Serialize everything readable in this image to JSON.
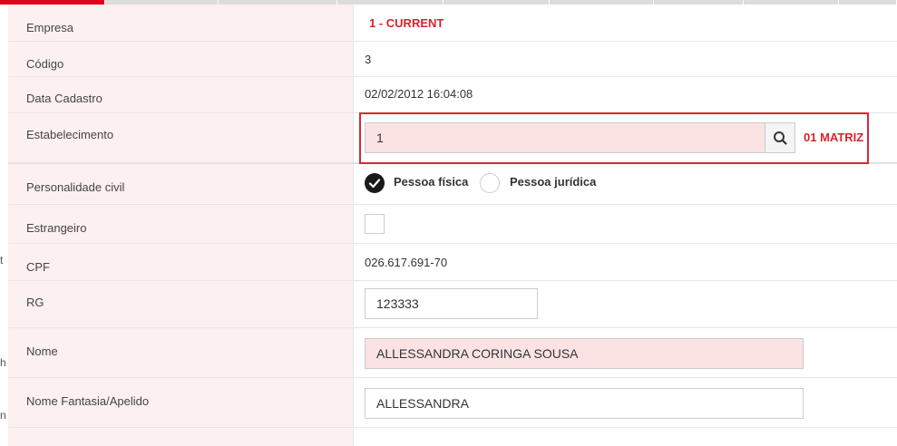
{
  "form": {
    "empresa": {
      "label": "Empresa",
      "value": "1 - CURRENT"
    },
    "codigo": {
      "label": "Código",
      "value": "3"
    },
    "data_cadastro": {
      "label": "Data Cadastro",
      "value": "02/02/2012 16:04:08"
    },
    "estabelecimento": {
      "label": "Estabelecimento",
      "input_value": "1",
      "description": "01 MATRIZ",
      "search_icon": "search-icon"
    },
    "personalidade_civil": {
      "label": "Personalidade civil",
      "options": [
        "Pessoa física",
        "Pessoa jurídica"
      ],
      "selected": "Pessoa física"
    },
    "estrangeiro": {
      "label": "Estrangeiro",
      "checked": false
    },
    "cpf": {
      "label": "CPF",
      "value": "026.617.691-70"
    },
    "rg": {
      "label": "RG",
      "input_value": "123333"
    },
    "nome": {
      "label": "Nome",
      "input_value": "ALLESSANDRA CORINGA SOUSA"
    },
    "nome_fantasia": {
      "label": "Nome Fantasia/Apelido",
      "input_value": "ALLESSANDRA"
    }
  },
  "left_partial_text": [
    "t",
    "h",
    "n"
  ],
  "colors": {
    "accent_red": "#d9232d",
    "required_bg": "#fbe3e3",
    "label_bg": "#fdf0f0"
  }
}
